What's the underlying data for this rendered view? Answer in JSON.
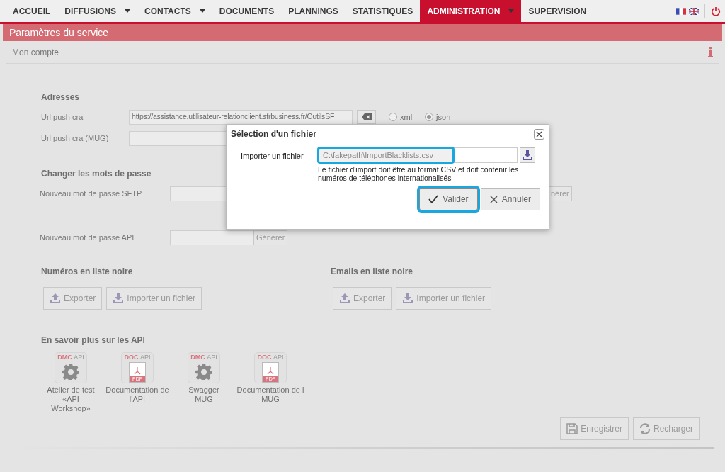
{
  "nav": [
    {
      "label": "ACCUEIL",
      "selected": false,
      "has_menu": false
    },
    {
      "label": "DIFFUSIONS",
      "selected": false,
      "has_menu": true
    },
    {
      "label": "CONTACTS",
      "selected": false,
      "has_menu": true
    },
    {
      "label": "DOCUMENTS",
      "selected": false,
      "has_menu": false
    },
    {
      "label": "PLANNINGS",
      "selected": false,
      "has_menu": false
    },
    {
      "label": "STATISTIQUES",
      "selected": false,
      "has_menu": false
    },
    {
      "label": "ADMINISTRATION",
      "selected": true,
      "has_menu": true
    },
    {
      "label": "SUPERVISION",
      "selected": false,
      "has_menu": false
    }
  ],
  "page_title": "Paramètres du service",
  "section_title": "Mon compte",
  "addresses": {
    "title": "Adresses",
    "url_label": "Url push cra",
    "url_value": "https://assistance.utilisateur-relationclient.sfrbusiness.fr/OutilsSF",
    "formats": [
      {
        "label": "xml",
        "selected": false
      },
      {
        "label": "json",
        "selected": true
      }
    ],
    "mug_label": "Url push cra (MUG)"
  },
  "passwords": {
    "title": "Changer les mots de passe",
    "sftp_label": "Nouveau mot de passe SFTP",
    "sftp_button": "nérer",
    "api_label": "Nouveau mot de passe API",
    "api_button": "Générer"
  },
  "blacklists": [
    {
      "title": "Numéros en liste noire",
      "export": "Exporter",
      "import": "Importer un fichier"
    },
    {
      "title": "Emails en liste noire",
      "export": "Exporter",
      "import": "Importer un fichier"
    }
  ],
  "api": {
    "title": "En savoir plus sur les API",
    "tiles": [
      {
        "kind": "tool",
        "badge": "DMC",
        "suffix": "API",
        "label": "Atelier de test\n«API\nWorkshop»"
      },
      {
        "kind": "doc",
        "badge": "DOC",
        "suffix": "API",
        "pdf": "PDF",
        "label": "Documentation de\nl'API"
      },
      {
        "kind": "tool",
        "badge": "DMC",
        "suffix": "API",
        "label": "Swagger\nMUG"
      },
      {
        "kind": "doc",
        "badge": "DOC",
        "suffix": "API",
        "pdf": "PDF",
        "label": "Documentation de l\nMUG"
      }
    ]
  },
  "actions": [
    "Enregistrer",
    "Recharger"
  ],
  "dialog": {
    "title": "Sélection d'un fichier",
    "label": "Importer un fichier",
    "value": "C:\\fakepath\\ImportBlacklists.csv",
    "hint": "Le fichier d'import doit être au format CSV et doit contenir les numéros de téléphones internationalisés",
    "buttons": [
      {
        "label": "Valider",
        "kind": "confirm",
        "focused": true
      },
      {
        "label": "Annuler",
        "kind": "cancel",
        "focused": false
      }
    ]
  }
}
